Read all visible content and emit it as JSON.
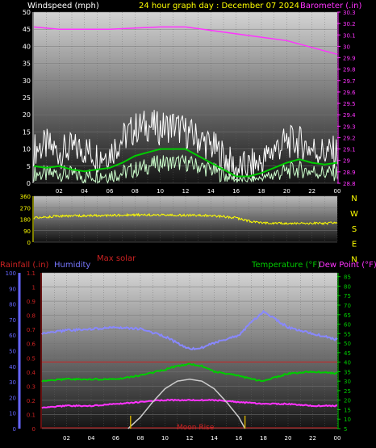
{
  "chart_data": [
    {
      "type": "line",
      "title": "24 hour graph day : December 07 2024",
      "left_axis_title": "Windspeed (mph)",
      "right_axis_title": "Barometer (.in)",
      "x_tick_labels": [
        "02",
        "04",
        "06",
        "08",
        "10",
        "12",
        "14",
        "16",
        "18",
        "20",
        "22",
        "00"
      ],
      "left_ticks": [
        "0",
        "5",
        "10",
        "15",
        "20",
        "25",
        "30",
        "35",
        "40",
        "45",
        "50"
      ],
      "right_ticks": [
        "28.8",
        "28.9",
        "29",
        "29.1",
        "29.2",
        "29.3",
        "29.4",
        "29.5",
        "29.6",
        "29.7",
        "29.8",
        "29.9",
        "30",
        "30.1",
        "30.2",
        "30.3"
      ],
      "left_range": [
        0,
        50
      ],
      "right_range": [
        28.8,
        30.3
      ],
      "series": [
        {
          "id": "barometer",
          "axis": "right",
          "hours": [
            0,
            2,
            4,
            6,
            8,
            10,
            12,
            14,
            16,
            18,
            20,
            22,
            24
          ],
          "values": [
            30.17,
            30.15,
            30.15,
            30.15,
            30.16,
            30.17,
            30.17,
            30.14,
            30.11,
            30.08,
            30.05,
            29.99,
            29.93
          ]
        },
        {
          "id": "gust",
          "axis": "left",
          "hours": [
            0,
            1,
            2,
            3,
            4,
            5,
            6,
            7,
            8,
            9,
            10,
            11,
            12,
            13,
            14,
            15,
            16,
            17,
            18,
            19,
            20,
            21,
            22,
            23,
            24
          ],
          "values": [
            10,
            11,
            9,
            10,
            10,
            8,
            9,
            13,
            16,
            17,
            16,
            17,
            15,
            13,
            11,
            8,
            4,
            5,
            6,
            10,
            12,
            12,
            10,
            9,
            9
          ]
        },
        {
          "id": "speed_avg",
          "axis": "left",
          "hours": [
            0,
            1,
            2,
            3,
            4,
            5,
            6,
            7,
            8,
            9,
            10,
            11,
            12,
            13,
            14,
            15,
            16,
            17,
            18,
            19,
            20,
            21,
            22,
            23,
            24
          ],
          "values": [
            5,
            4.5,
            5,
            4,
            3.5,
            4,
            4.5,
            6,
            8,
            9,
            10,
            10,
            10,
            8,
            6,
            4,
            2,
            2,
            3,
            4.5,
            6,
            7,
            6,
            5.5,
            6
          ]
        },
        {
          "id": "speed",
          "axis": "left",
          "hours": [
            0,
            1,
            2,
            3,
            4,
            5,
            6,
            7,
            8,
            9,
            10,
            11,
            12,
            13,
            14,
            15,
            16,
            17,
            18,
            19,
            20,
            21,
            22,
            23,
            24
          ],
          "values": [
            3,
            2.5,
            3,
            2.5,
            2,
            2.5,
            2.5,
            3,
            4,
            5,
            6,
            6,
            6,
            5,
            4,
            2.5,
            1,
            1,
            1.5,
            2.5,
            3.5,
            4,
            3.5,
            3,
            3
          ]
        }
      ],
      "colors": {
        "barometer": "#ff33ff",
        "gust": "#ffffff",
        "speed": "#ccffcc",
        "speed_avg": "#00cc00"
      }
    },
    {
      "type": "line",
      "left_ticks": [
        "360",
        "270",
        "180",
        "90",
        "0"
      ],
      "right_labels": [
        "N",
        "W",
        "S",
        "E",
        "N"
      ],
      "left_range": [
        0,
        360
      ],
      "series": [
        {
          "id": "wind_direction",
          "hours": [
            0,
            1,
            2,
            3,
            4,
            5,
            6,
            7,
            8,
            9,
            10,
            11,
            12,
            13,
            14,
            15,
            16,
            17,
            18,
            19,
            20,
            21,
            22,
            23,
            24
          ],
          "values": [
            190,
            198,
            203,
            206,
            206,
            208,
            209,
            212,
            213,
            214,
            213,
            212,
            211,
            210,
            207,
            200,
            190,
            165,
            150,
            148,
            148,
            147,
            148,
            148,
            150
          ]
        }
      ],
      "colors": {
        "wind_direction": "#ffff00"
      },
      "footer_label": "Max solar",
      "footer_color": "#cc2222"
    },
    {
      "type": "line",
      "rain_axis_title": "Rainfall (.in)",
      "humidity_axis_title": "Humidity",
      "right_axis_title_1": "Temperature (°F)",
      "right_axis_title_2": "Dew Point (°F)",
      "x_tick_labels": [
        "02",
        "04",
        "06",
        "08",
        "10",
        "12",
        "14",
        "16",
        "18",
        "20",
        "22",
        "00"
      ],
      "humidity_ticks": [
        "0",
        "10",
        "20",
        "30",
        "40",
        "50",
        "60",
        "70",
        "80",
        "90",
        "100"
      ],
      "rain_ticks": [
        "0",
        "0.1",
        "0.2",
        "0.3",
        "0.4",
        "0.5",
        "0.6",
        "0.7",
        "0.8",
        "0.9",
        "1",
        "1.1"
      ],
      "temp_ticks": [
        "5",
        "10",
        "15",
        "20",
        "25",
        "30",
        "35",
        "40",
        "45",
        "50",
        "55",
        "60",
        "65",
        "70",
        "75",
        "80",
        "85"
      ],
      "humidity_range": [
        0,
        100
      ],
      "rain_range": [
        0,
        1.1
      ],
      "temp_range": [
        5,
        87
      ],
      "series": [
        {
          "id": "humidity",
          "hours": [
            0,
            2,
            4,
            6,
            8,
            10,
            11,
            12,
            13,
            14,
            16,
            17,
            18,
            19,
            20,
            22,
            24
          ],
          "values": [
            61,
            63,
            64,
            65,
            64,
            59,
            55,
            51,
            52,
            55,
            60,
            68,
            75,
            70,
            65,
            61,
            57
          ]
        },
        {
          "id": "temperature",
          "hours": [
            0,
            2,
            4,
            6,
            8,
            10,
            11,
            12,
            13,
            14,
            16,
            17,
            18,
            19,
            20,
            22,
            24
          ],
          "values": [
            30,
            31,
            31,
            31,
            33,
            36,
            38,
            39,
            38,
            35,
            33,
            31,
            30,
            32,
            34,
            35,
            34
          ]
        },
        {
          "id": "dew_point",
          "hours": [
            0,
            2,
            4,
            6,
            8,
            10,
            12,
            14,
            16,
            18,
            20,
            22,
            24
          ],
          "values": [
            16,
            17,
            17,
            18,
            19,
            20,
            20,
            20,
            19,
            18,
            18,
            17,
            17
          ]
        },
        {
          "id": "solar",
          "hours": [
            7,
            8,
            9,
            10,
            11,
            12,
            13,
            14,
            15,
            16,
            16.5
          ],
          "values": [
            0,
            6,
            14,
            21,
            25,
            26,
            25,
            21,
            14,
            6,
            0
          ]
        }
      ],
      "rain_threshold": 0.47,
      "moon_rise_label": "Moon Rise",
      "moon_markers_hours": [
        7.2,
        16.5
      ],
      "colors": {
        "humidity": "#8888ff",
        "temperature": "#00cc00",
        "dew_point": "#ff33ff",
        "solar": "#cccccc",
        "rain_axis": "#cc2222",
        "humidity_axis": "#6666ff",
        "temp_axis": "#00cc00",
        "moon": "#ccaa00"
      }
    }
  ]
}
